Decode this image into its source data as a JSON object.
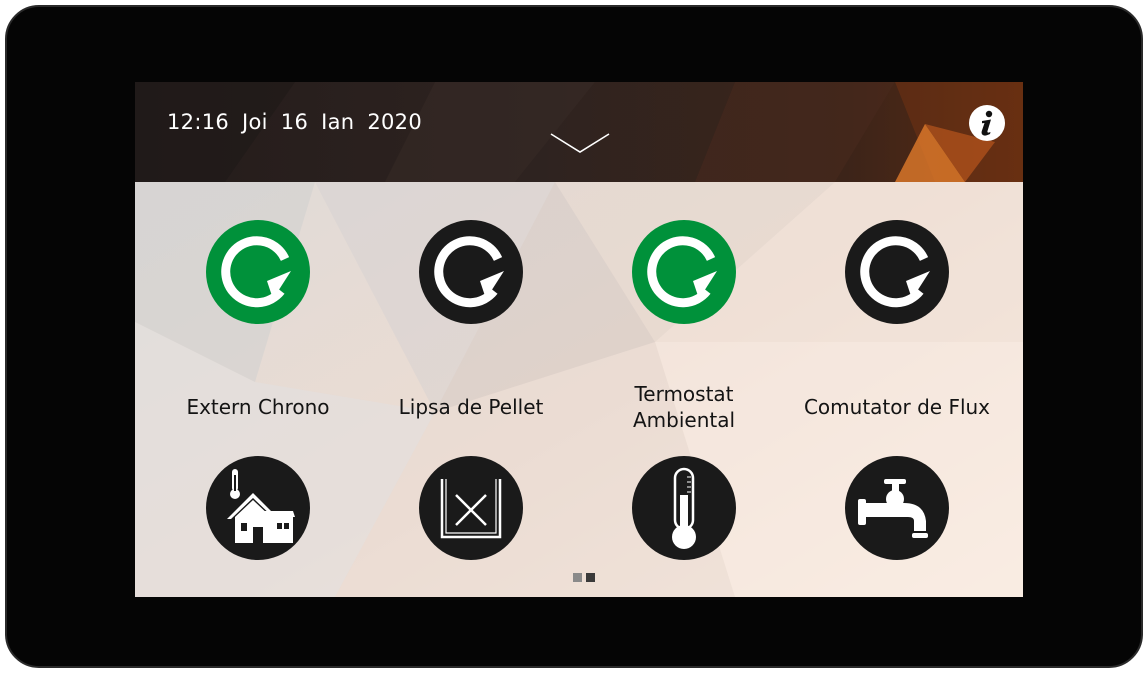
{
  "header": {
    "time": "12:16",
    "weekday": "Joi",
    "day": "16",
    "month": "Ian",
    "year": "2020",
    "menu_toggle_icon": "chevron-down-icon",
    "info_icon": "info-icon"
  },
  "tiles": [
    {
      "label": "Extern Chrono",
      "status": "active",
      "status_color": "#00913a",
      "device_icon": "house-thermometer-icon"
    },
    {
      "label": "Lipsa de Pellet",
      "status": "inactive",
      "status_color": "#1a1a1a",
      "device_icon": "pellet-empty-icon"
    },
    {
      "label": "Termostat Ambiental",
      "status": "active",
      "status_color": "#00913a",
      "device_icon": "thermometer-icon"
    },
    {
      "label": "Comutator de Flux",
      "status": "inactive",
      "status_color": "#1a1a1a",
      "device_icon": "faucet-icon"
    }
  ],
  "pager": {
    "total": 2,
    "current": 2
  },
  "colors": {
    "active": "#00913a",
    "inactive": "#1a1a1a",
    "bezel": "#050505",
    "header": "#2a1e1a"
  }
}
